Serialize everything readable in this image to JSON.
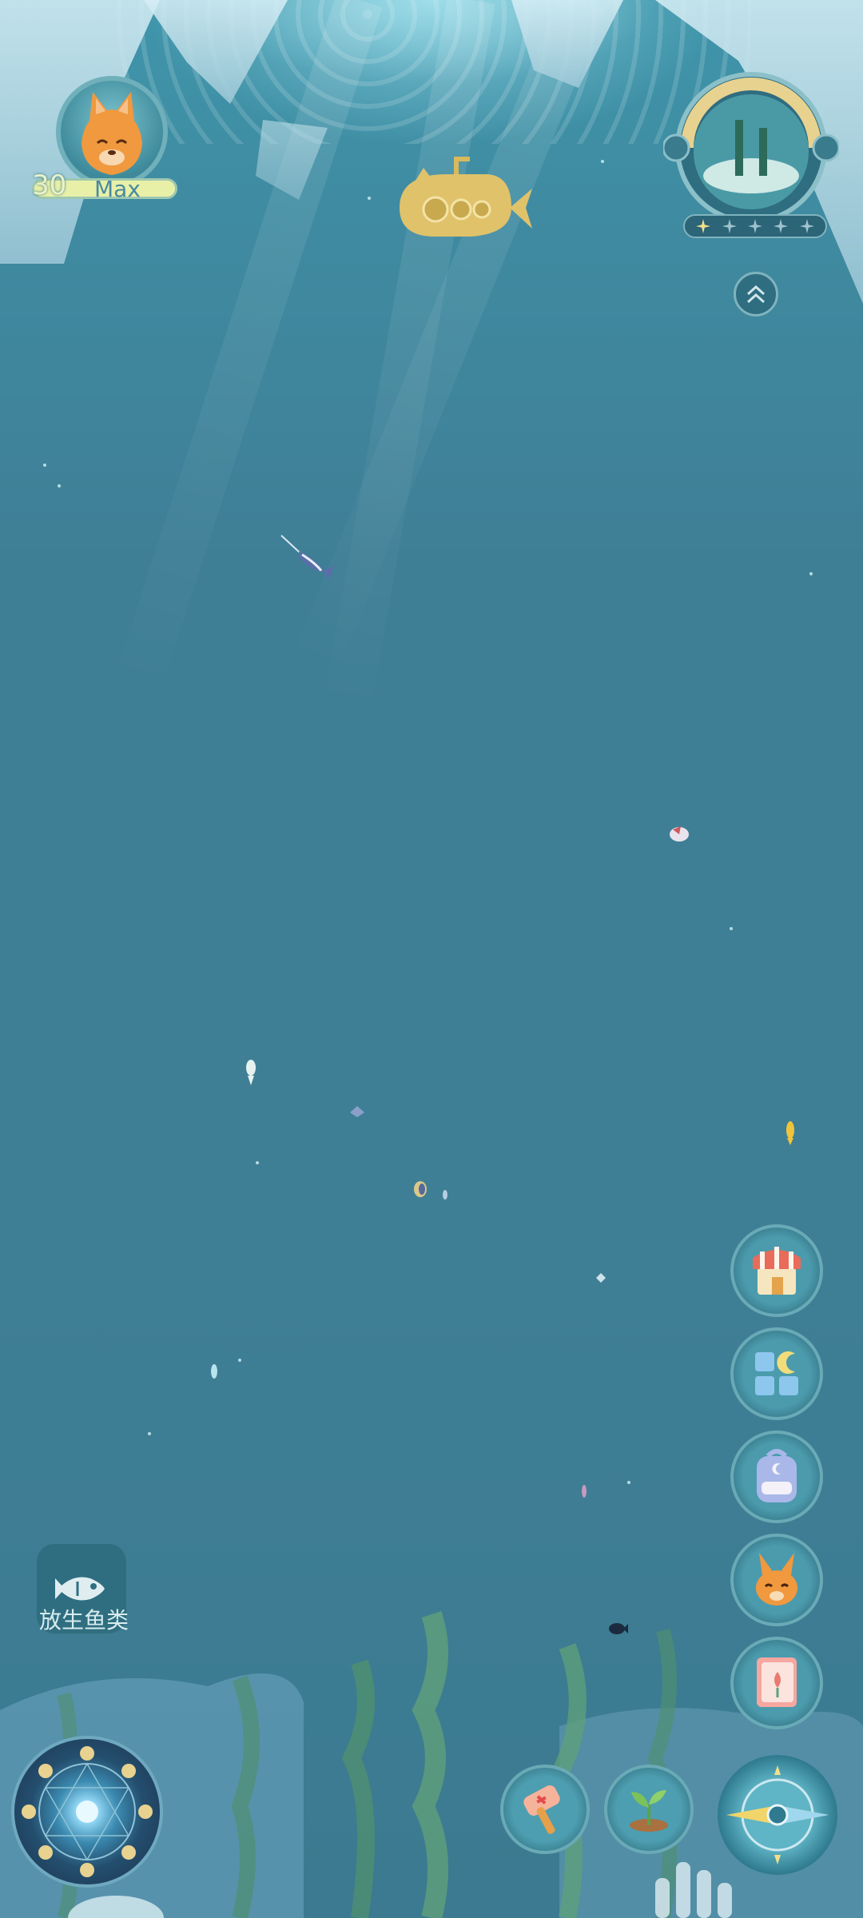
{
  "player": {
    "level": "30",
    "level_status": "Max",
    "avatar": "orange-fox-avatar"
  },
  "habitat": {
    "icon": "reef-habitat-icon",
    "stars_filled": 1,
    "stars_total": 5,
    "expand_icon": "double-chevron-up-icon"
  },
  "side_menu": [
    {
      "id": "shop",
      "icon": "shop-awning-icon"
    },
    {
      "id": "collection",
      "icon": "moon-grid-icon"
    },
    {
      "id": "backpack",
      "icon": "backpack-icon"
    },
    {
      "id": "pet",
      "icon": "orange-rabbit-icon"
    },
    {
      "id": "handbook",
      "icon": "flower-book-icon"
    }
  ],
  "release_fish": {
    "label": "放生鱼类",
    "icon": "fish-icon"
  },
  "bottom_bar": [
    {
      "id": "hammer",
      "icon": "hammer-icon"
    },
    {
      "id": "plant",
      "icon": "sprout-icon"
    },
    {
      "id": "compass",
      "icon": "compass-icon"
    }
  ],
  "moon_wheel": {
    "icon": "moon-phase-wheel-icon"
  },
  "colors": {
    "water": "#3f7f95",
    "accent_ring": "#6aaab7",
    "level_bar": "#e8f0a8",
    "submarine": "#e0c26a"
  }
}
